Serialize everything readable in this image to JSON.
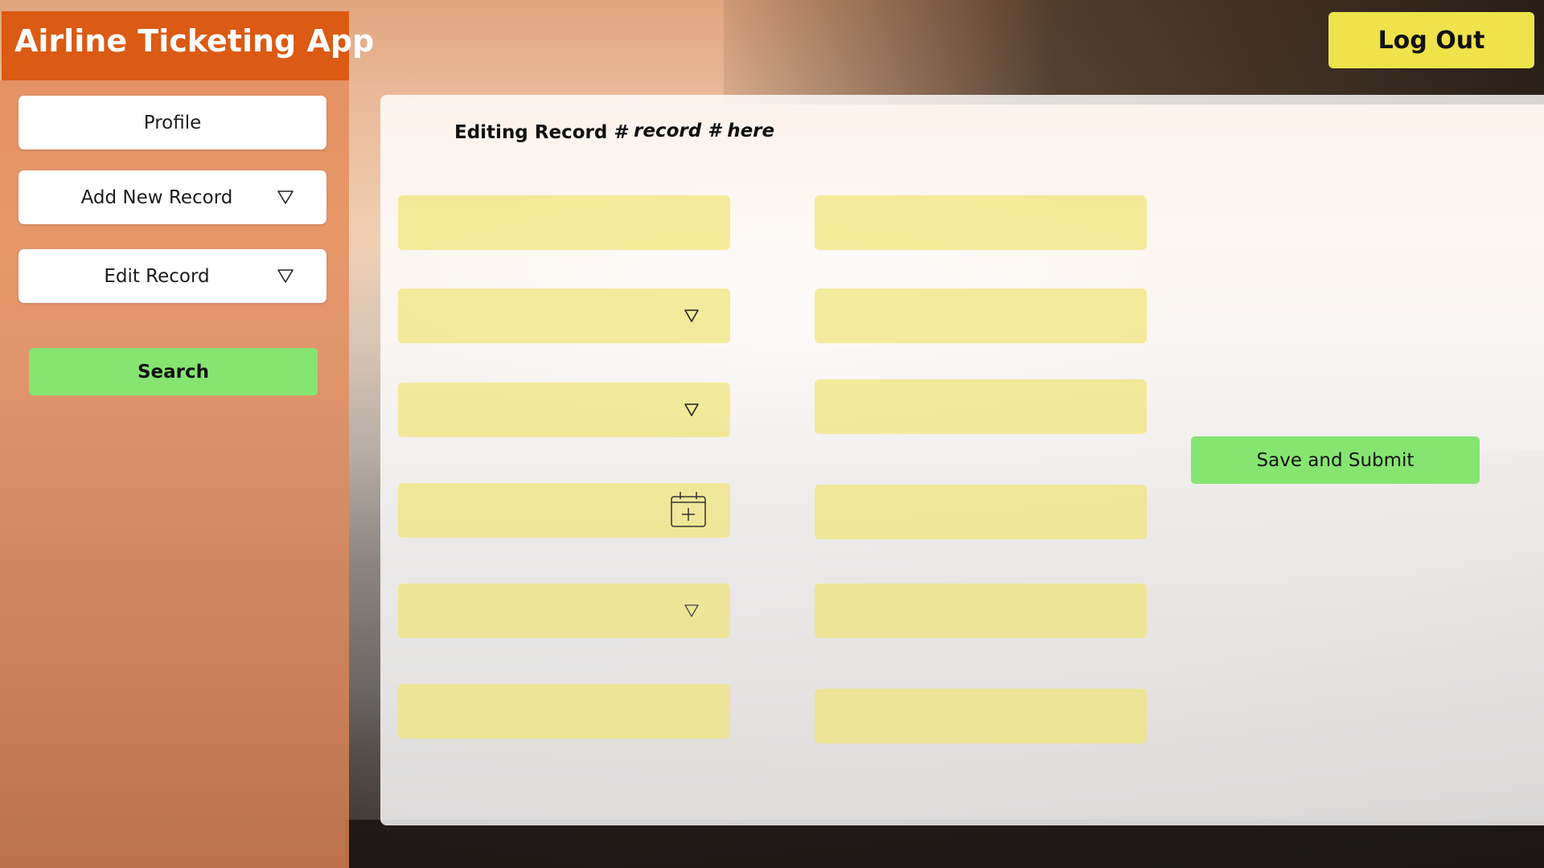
{
  "app": {
    "title": "Airline Ticketing App"
  },
  "header": {
    "logout_label": "Log Out"
  },
  "sidebar": {
    "items": [
      {
        "label": "Profile",
        "icon": ""
      },
      {
        "label": "Add New Record",
        "icon": "chevron-down-icon"
      },
      {
        "label": "Edit Record",
        "icon": "chevron-down-icon"
      }
    ],
    "search_label": "Search"
  },
  "main": {
    "editing_label": "Editing Record #",
    "record_number": "record # here",
    "save_label": "Save and Submit",
    "fields_left": [
      {
        "value": "",
        "icon": ""
      },
      {
        "value": "",
        "icon": "chevron-down-icon"
      },
      {
        "value": "",
        "icon": "chevron-down-icon"
      },
      {
        "value": "",
        "icon": "calendar-add-icon"
      },
      {
        "value": "",
        "icon": "chevron-down-icon"
      },
      {
        "value": "",
        "icon": ""
      }
    ],
    "fields_right": [
      {
        "value": ""
      },
      {
        "value": ""
      },
      {
        "value": ""
      },
      {
        "value": ""
      },
      {
        "value": ""
      },
      {
        "value": ""
      }
    ]
  },
  "colors": {
    "title_bg": "#db5a14",
    "sidebar_bg": "#e48856",
    "button_green": "#86e571",
    "logout_yellow": "#efe24a",
    "field_yellow": "#f0e478"
  }
}
